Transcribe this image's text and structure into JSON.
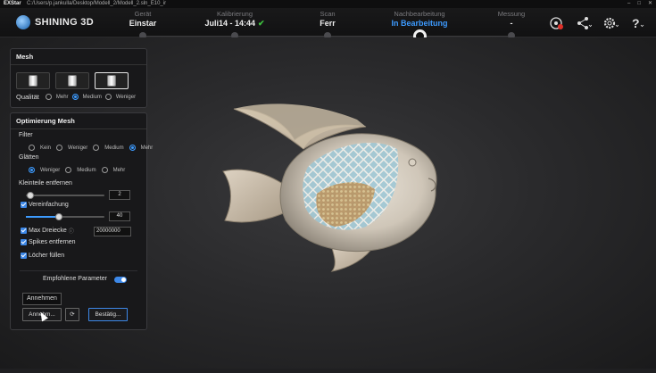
{
  "titlebar": {
    "app": "EXStar",
    "path": "C:/Users/p.jankulla/Desktop/Modell_2/Modell_2.sln_E10_ir",
    "controls": [
      "–",
      "□",
      "✕"
    ]
  },
  "brand": {
    "name": "SHINING 3D"
  },
  "steps": [
    {
      "label": "Gerät",
      "value": "Einstar"
    },
    {
      "label": "Kalibrierung",
      "value": "Juli14 - 14:44",
      "check": "✔"
    },
    {
      "label": "Scan",
      "value": "Ferr"
    },
    {
      "label": "Nachbearbeitung",
      "value": "In Bearbeitung"
    },
    {
      "label": "Messung",
      "value": "-"
    }
  ],
  "header_icons": [
    "measure-icon",
    "share-icon",
    "settings-icon",
    "help-icon"
  ],
  "mesh_panel": {
    "title": "Mesh",
    "quality_label": "Qualität",
    "options": [
      "Mehr",
      "Medium",
      "Weniger"
    ],
    "selected": "Medium"
  },
  "optimize_panel": {
    "title": "Optimierung Mesh",
    "filter_label": "Filter",
    "filter_options": [
      "Kein",
      "Weniger",
      "Medium",
      "Mehr"
    ],
    "filter_selected": "Mehr",
    "smooth_label": "Glätten",
    "smooth_options": [
      "Weniger",
      "Medium",
      "Mehr"
    ],
    "smooth_selected": "Weniger",
    "small_parts_label": "Kleinteile entfernen",
    "small_parts_value": "2",
    "simplify_label": "Vereinfachung",
    "simplify_value": "40",
    "max_triangles_label": "Max Dreiecke",
    "max_triangles_info": "ⓘ",
    "max_triangles_value": "20000000",
    "spikes_label": "Spikes entfernen",
    "holes_label": "Löcher füllen",
    "recommended_label": "Empfohlene Parameter",
    "tooltip": "Annehmen",
    "apply_button": "Annehm...",
    "confirm_button": "Bestätig...",
    "refresh_icon": "⟳"
  },
  "colors": {
    "accent": "#3d9bff",
    "check": "#3fc23f"
  }
}
